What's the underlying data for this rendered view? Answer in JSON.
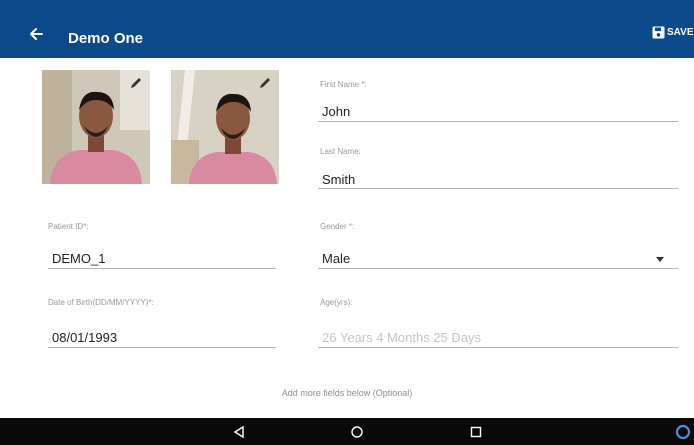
{
  "appbar": {
    "title": "Demo One",
    "save_label": "SAVE",
    "back_icon": "arrow-left-icon",
    "save_icon": "floppy-disk-icon",
    "color": "#0d4a8c"
  },
  "photos": [
    {
      "alt": "profile photo",
      "edit_icon": "pencil-icon"
    },
    {
      "alt": "profile photo",
      "edit_icon": "pencil-icon"
    }
  ],
  "form": {
    "first_name": {
      "label": "First Name *:",
      "value": "John"
    },
    "last_name": {
      "label": "Last Name:",
      "value": "Smith"
    },
    "patient_id": {
      "label": "Patient ID*:",
      "value": "DEMO_1"
    },
    "gender": {
      "label": "Gender *:",
      "value": "Male"
    },
    "dob": {
      "label": "Date of Birth(DD/MM/YYYY)*:",
      "value": "08/01/1993"
    },
    "age": {
      "label": "Age(yrs):",
      "value": "26 Years 4 Months 25 Days"
    }
  },
  "hint": "Add more fields below (Optional)",
  "navbar": {
    "back_icon": "triangle-back-icon",
    "home_icon": "circle-home-icon",
    "recents_icon": "square-recents-icon",
    "assistant_icon": "assistant-icon"
  }
}
